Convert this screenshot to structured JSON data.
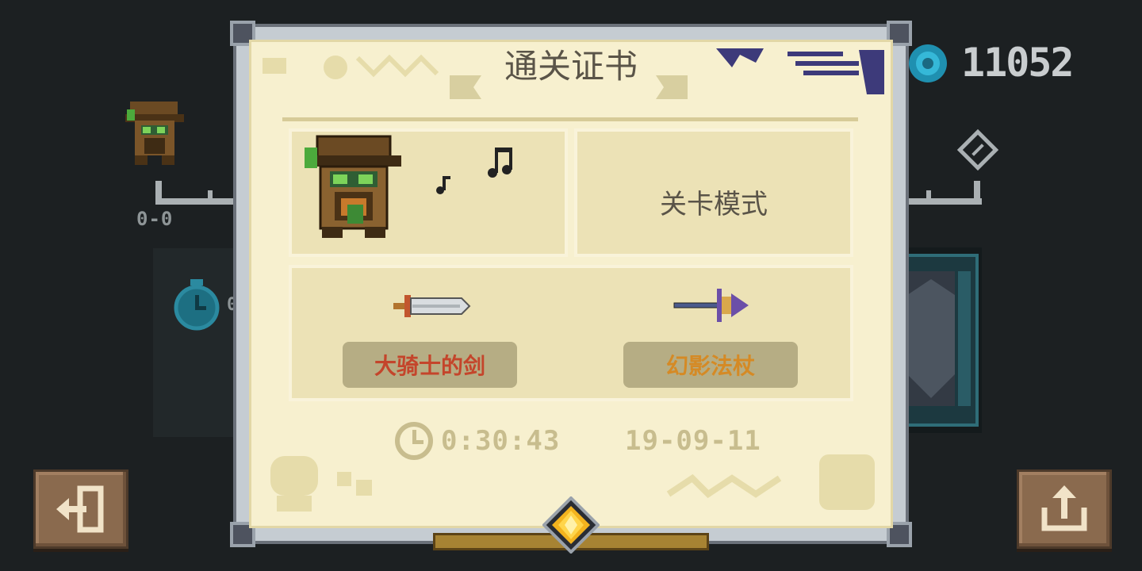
{
  "background": {
    "score": "0-0",
    "stopwatch_partial": "0",
    "gems": "11052"
  },
  "certificate": {
    "title": "通关证书",
    "mode": "关卡模式",
    "weapons": [
      {
        "name": "大骑士的剑",
        "color": "#c4452b"
      },
      {
        "name": "幻影法杖",
        "color": "#d58a25"
      }
    ],
    "time": "0:30:43",
    "date": "19-09-11"
  },
  "icons": {
    "gem": "gem-icon",
    "exit": "exit-icon",
    "share": "share-icon",
    "clock": "clock-icon",
    "music": "music-note-icon",
    "medal": "medal-icon"
  }
}
